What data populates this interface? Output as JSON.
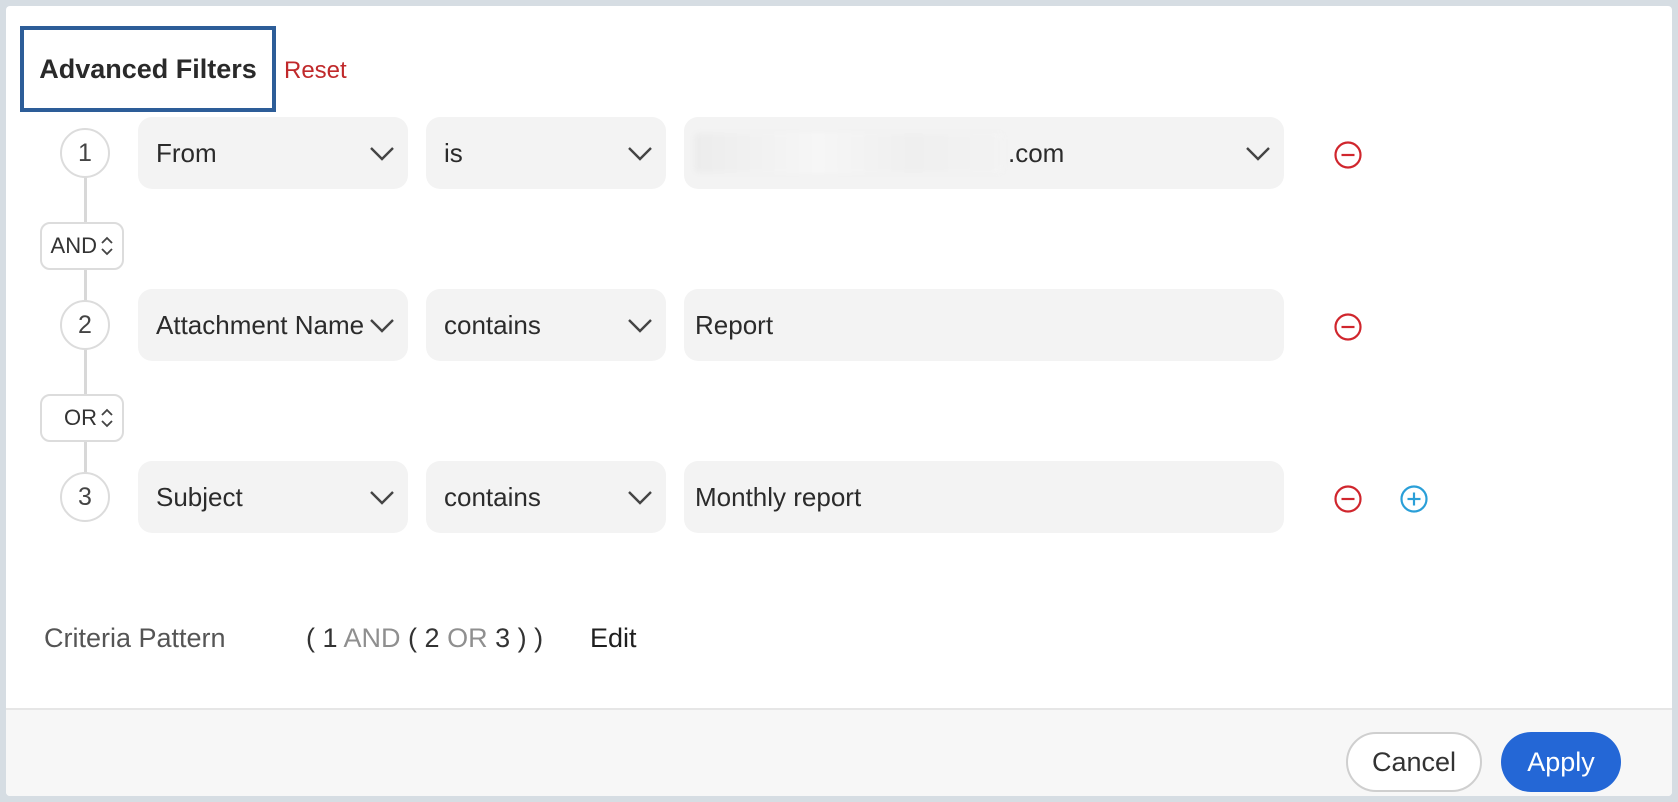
{
  "header": {
    "title": "Advanced Filters",
    "reset_label": "Reset"
  },
  "rows": [
    {
      "number": "1",
      "field": "From",
      "operator": "is",
      "value_suffix": ".com",
      "value_blurred": true
    },
    {
      "number": "2",
      "field": "Attachment Name",
      "operator": "contains",
      "value": "Report"
    },
    {
      "number": "3",
      "field": "Subject",
      "operator": "contains",
      "value": "Monthly report"
    }
  ],
  "connectors": [
    "AND",
    "OR"
  ],
  "criteria": {
    "label": "Criteria Pattern",
    "p1": "( 1 ",
    "op1": "AND",
    "p2": " ( 2 ",
    "op2": "OR",
    "p3": " 3 ) )",
    "edit_label": "Edit"
  },
  "footer": {
    "cancel_label": "Cancel",
    "apply_label": "Apply"
  },
  "colors": {
    "remove_icon": "#d0262d",
    "add_icon": "#2a9fd8",
    "apply_button": "#2467d6",
    "title_border": "#2d5d98"
  },
  "icons": {
    "remove": "minus-circle-icon",
    "add": "plus-circle-icon",
    "dropdown": "chevron-down-icon",
    "logic_toggle": "up-down-chevron-icon"
  }
}
